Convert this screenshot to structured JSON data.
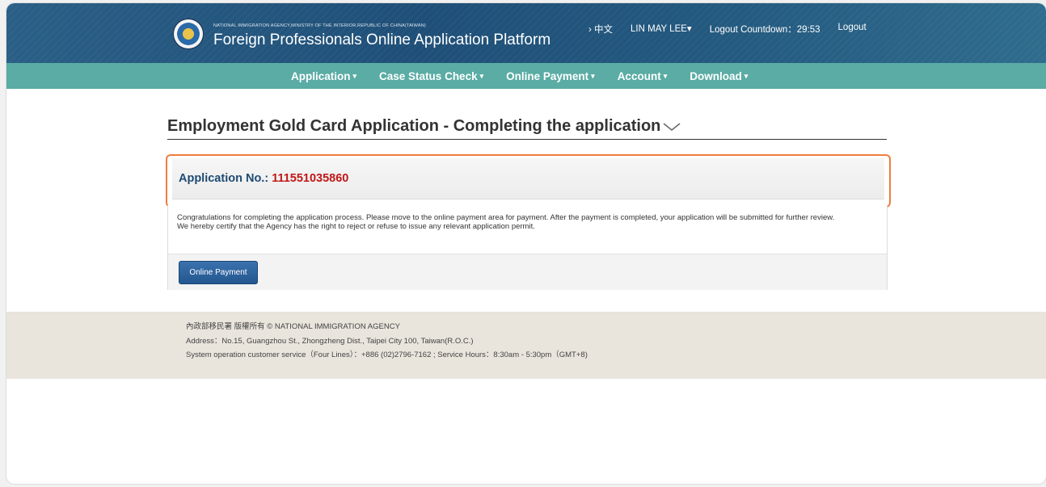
{
  "header": {
    "agency": "NATIONAL IMMIGRATION AGENCY,MINISTRY OF THE INTERIOR,REPUBLIC OF CHINA(TAIWAN)",
    "platform_title": "Foreign Professionals Online Application Platform",
    "language_link": "› 中文",
    "user": "LIN MAY LEE",
    "logout_countdown": "Logout Countdown：29:53",
    "logout": "Logout"
  },
  "nav": {
    "items": [
      {
        "label": "Application"
      },
      {
        "label": "Case Status Check"
      },
      {
        "label": "Online Payment"
      },
      {
        "label": "Account"
      },
      {
        "label": "Download"
      }
    ],
    "caret": "▾"
  },
  "page": {
    "title": "Employment Gold Card Application - Completing the application",
    "application_no_label": "Application No.: ",
    "application_no": "111551035860",
    "message_line1": "Congratulations for completing the application process. Please move to the online payment area for payment. After the payment is completed, your application will be submitted for further review.",
    "message_line2": "We hereby certify that the Agency has the right to reject or refuse to issue any relevant application permit.",
    "payment_button": "Online Payment"
  },
  "footer": {
    "copyright": "內政部移民署 版權所有 © NATIONAL IMMIGRATION AGENCY",
    "address": "Address：No.15, Guangzhou St., Zhongzheng Dist., Taipei City 100, Taiwan(R.O.C.)",
    "service": "System operation customer service（Four Lines）：+886 (02)2796-7162 ; Service Hours：8:30am - 5:30pm（GMT+8)"
  },
  "colors": {
    "header": "#1f4f78",
    "nav": "#5aaca4",
    "highlight_border": "#ef7d3e",
    "application_no": "#c01818",
    "button": "#24578f",
    "footer": "#e9e4dc"
  }
}
